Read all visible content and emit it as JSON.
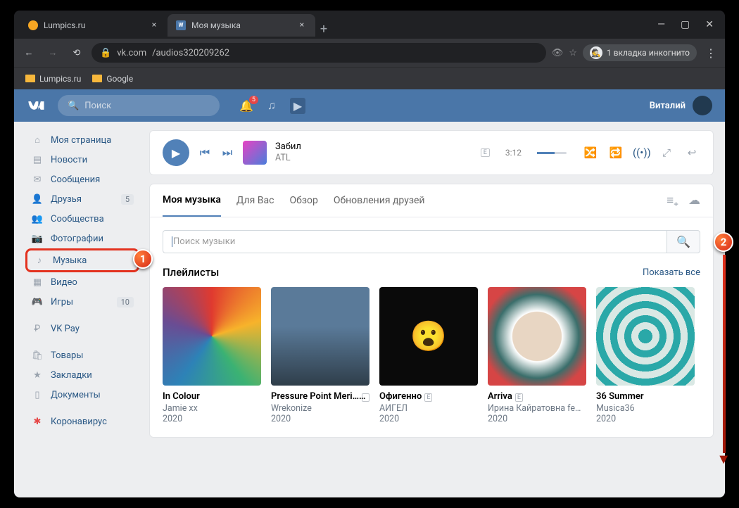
{
  "browser": {
    "tabs": [
      {
        "title": "Lumpics.ru",
        "active": false,
        "fav_color": "#f6a623"
      },
      {
        "title": "Моя музыка",
        "active": true,
        "fav_color": "#4a76a8"
      }
    ],
    "url_host": "vk.com",
    "url_path": "/audios320209262",
    "incognito_label": "1 вкладка инкогнито",
    "bookmarks": [
      "Lumpics.ru",
      "Google"
    ]
  },
  "vk": {
    "search_placeholder": "Поиск",
    "notif_count": "5",
    "username": "Виталий",
    "sidebar": [
      {
        "label": "Моя страница",
        "icon": "home"
      },
      {
        "label": "Новости",
        "icon": "news"
      },
      {
        "label": "Сообщения",
        "icon": "msg"
      },
      {
        "label": "Друзья",
        "icon": "friends",
        "count": "5"
      },
      {
        "label": "Сообщества",
        "icon": "groups"
      },
      {
        "label": "Фотографии",
        "icon": "photos"
      },
      {
        "label": "Музыка",
        "icon": "music",
        "selected": true
      },
      {
        "label": "Видео",
        "icon": "video"
      },
      {
        "label": "Игры",
        "icon": "games",
        "count": "10"
      },
      {
        "label": "VK Pay",
        "icon": "pay",
        "sep": true
      },
      {
        "label": "Товары",
        "icon": "shop",
        "sep": true
      },
      {
        "label": "Закладки",
        "icon": "fav"
      },
      {
        "label": "Документы",
        "icon": "docs"
      },
      {
        "label": "Коронавирус",
        "icon": "covid",
        "sep": true
      }
    ],
    "player": {
      "track": "Забил",
      "artist": "ATL",
      "time": "3:12"
    },
    "music_tabs": [
      "Моя музыка",
      "Для Вас",
      "Обзор",
      "Обновления друзей"
    ],
    "music_search_placeholder": "Поиск музыки",
    "playlists_title": "Плейлисты",
    "show_all": "Показать все",
    "playlists": [
      {
        "name": "In Colour",
        "artist": "Jamie xx",
        "year": "2020",
        "explicit": false
      },
      {
        "name": "Pressure Point Meri…",
        "artist": "Wrekonize",
        "year": "2020",
        "explicit": true
      },
      {
        "name": "Офигенно",
        "artist": "АИГЕЛ",
        "year": "2020",
        "explicit": true
      },
      {
        "name": "Arriva",
        "artist": "Ирина Кайратовна fe…",
        "year": "2020",
        "explicit": true
      },
      {
        "name": "36 Summer",
        "artist": "Musica36",
        "year": "2020",
        "explicit": false
      }
    ]
  },
  "markers": {
    "m1": "1",
    "m2": "2"
  }
}
